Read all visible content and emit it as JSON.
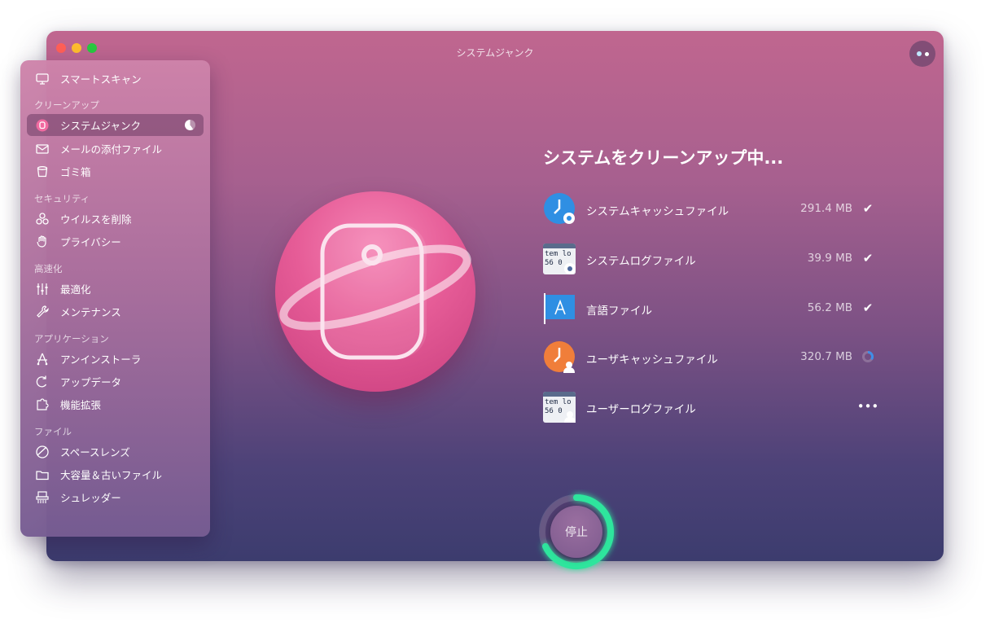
{
  "window": {
    "title": "システムジャンク"
  },
  "sidebar": {
    "top_item": {
      "label": "スマートスキャン",
      "icon": "smart-scan-icon"
    },
    "sections": [
      {
        "header": "クリーンアップ",
        "items": [
          {
            "label": "システムジャンク",
            "icon": "system-junk-icon",
            "active": true
          },
          {
            "label": "メールの添付ファイル",
            "icon": "mail-icon"
          },
          {
            "label": "ゴミ箱",
            "icon": "trash-icon"
          }
        ]
      },
      {
        "header": "セキュリティ",
        "items": [
          {
            "label": "ウイルスを削除",
            "icon": "biohazard-icon"
          },
          {
            "label": "プライバシー",
            "icon": "hand-icon"
          }
        ]
      },
      {
        "header": "高速化",
        "items": [
          {
            "label": "最適化",
            "icon": "sliders-icon"
          },
          {
            "label": "メンテナンス",
            "icon": "wrench-icon"
          }
        ]
      },
      {
        "header": "アプリケーション",
        "items": [
          {
            "label": "アンインストーラ",
            "icon": "uninstaller-icon"
          },
          {
            "label": "アップデータ",
            "icon": "updater-icon"
          },
          {
            "label": "機能拡張",
            "icon": "puzzle-icon"
          }
        ]
      },
      {
        "header": "ファイル",
        "items": [
          {
            "label": "スペースレンズ",
            "icon": "space-lens-icon"
          },
          {
            "label": "大容量＆古いファイル",
            "icon": "folder-icon"
          },
          {
            "label": "シュレッダー",
            "icon": "shredder-icon"
          }
        ]
      }
    ]
  },
  "main": {
    "heading": "システムをクリーンアップ中...",
    "files": [
      {
        "name": "システムキャッシュファイル",
        "size": "291.4 MB",
        "status": "done",
        "status_glyph": "✔",
        "icon": "system-cache-icon"
      },
      {
        "name": "システムログファイル",
        "size": "39.9 MB",
        "status": "done",
        "status_glyph": "✔",
        "icon": "system-log-icon"
      },
      {
        "name": "言語ファイル",
        "size": "56.2 MB",
        "status": "done",
        "status_glyph": "✔",
        "icon": "language-files-icon"
      },
      {
        "name": "ユーザキャッシュファイル",
        "size": "320.7 MB",
        "status": "in-progress",
        "status_glyph": "",
        "icon": "user-cache-icon"
      },
      {
        "name": "ユーザーログファイル",
        "size": "",
        "status": "pending",
        "status_glyph": "•••",
        "icon": "user-log-icon"
      }
    ],
    "terminal_icon_text": "tem lo\n56 0",
    "stop_button": "停止",
    "progress": 0.68,
    "in_progress_fraction": 0.35
  },
  "colors": {
    "accent_green": "#2ee59d",
    "icon_pink": "#e65c97",
    "cache_blue": "#2f8fe3",
    "cache_orange": "#f07e3a",
    "close": "#ff5f57",
    "minimize": "#febc2e",
    "maximize": "#28c840"
  }
}
